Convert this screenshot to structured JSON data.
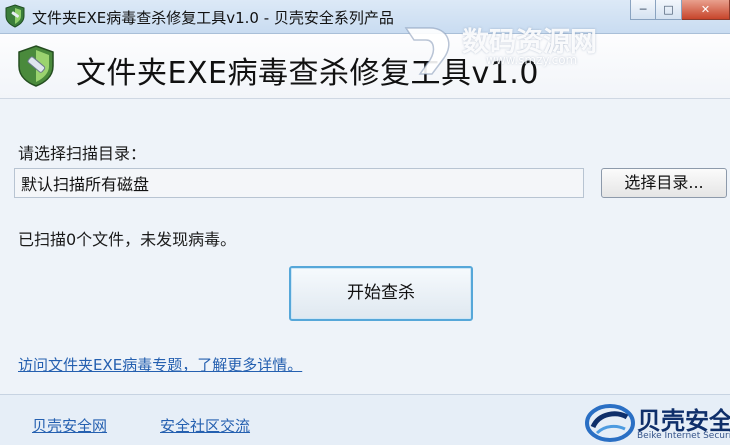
{
  "window": {
    "title": "文件夹EXE病毒查杀修复工具v1.0 - 贝壳安全系列产品",
    "minimize_glyph": "─",
    "maximize_glyph": "□",
    "close_glyph": "✕"
  },
  "header": {
    "heading": "文件夹EXE病毒查杀修复工具v1.0"
  },
  "watermark": {
    "text": "数码资源网",
    "url": "www.smzy.com"
  },
  "scan": {
    "dir_label": "请选择扫描目录：",
    "dir_value": "默认扫描所有磁盘",
    "select_button": "选择目录...",
    "status": "已扫描0个文件，未发现病毒。",
    "start_button": "开始查杀"
  },
  "links": {
    "topic": "访问文件夹EXE病毒专题，了解更多详情。"
  },
  "footer": {
    "site_link": "贝壳安全网",
    "community_link": "安全社区交流",
    "brand_name": "贝壳安全",
    "brand_sub": "Beike Internet Security"
  },
  "icons": {
    "app": "shield-icon",
    "logo": "shield-logo-icon",
    "brand": "shell-logo-icon"
  },
  "colors": {
    "link": "#2560b0",
    "start_border": "#56a7d9",
    "brand": "#0f2f6a"
  }
}
